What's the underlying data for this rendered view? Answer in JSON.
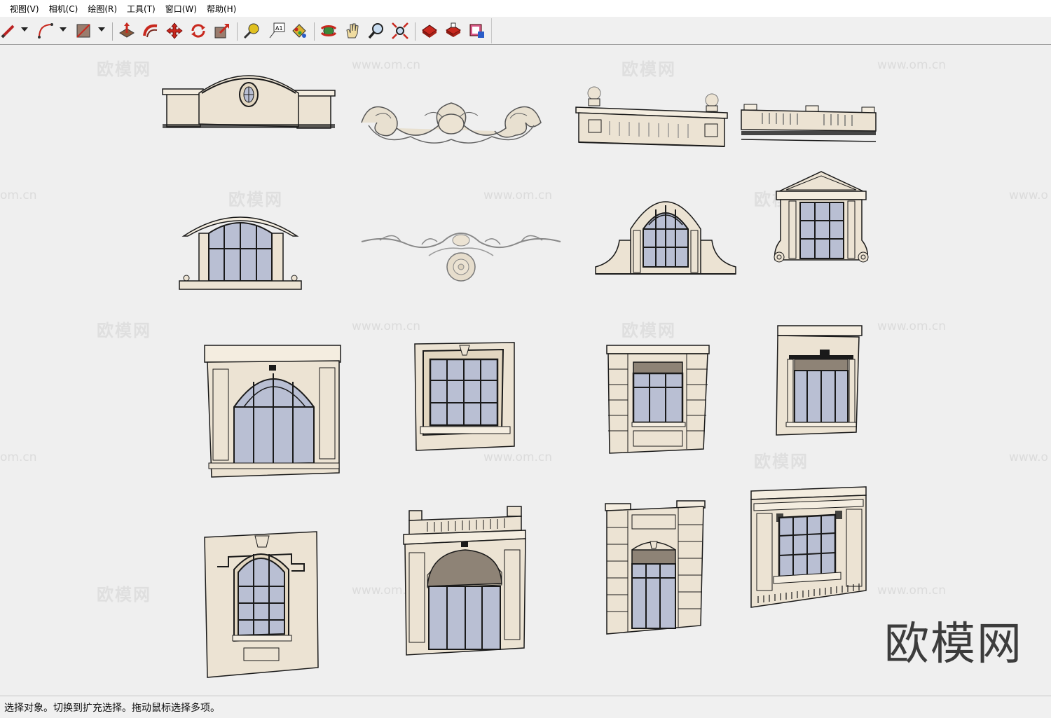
{
  "menu": {
    "items": [
      {
        "label": "视图(V)"
      },
      {
        "label": "相机(C)"
      },
      {
        "label": "绘图(R)"
      },
      {
        "label": "工具(T)"
      },
      {
        "label": "窗口(W)"
      },
      {
        "label": "帮助(H)"
      }
    ]
  },
  "toolbar": {
    "tools": [
      "pencil-icon",
      "arc-icon",
      "rectangle-icon",
      "push-pull-icon",
      "follow-me-icon",
      "move-icon",
      "rotate-icon",
      "scale-icon",
      "tape-measure-icon",
      "text-icon",
      "paint-bucket-icon",
      "orbit-icon",
      "pan-icon",
      "zoom-icon",
      "zoom-extents-icon",
      "warehouse-icon",
      "share-model-icon",
      "extension-icon"
    ],
    "text_tool_label": "A1"
  },
  "watermarks": {
    "site_name": "欧模网",
    "site_url": "www.om.cn",
    "site_url_partial": "om.cn",
    "site_url_cut": "www.o"
  },
  "viewport": {
    "big_watermark": "欧模网"
  },
  "status": {
    "text": "选择对象。切换到扩充选择。拖动鼠标选择多项。"
  },
  "colors": {
    "stone": "#ece3d3",
    "stone_dark": "#d8cdb8",
    "glass": "#b9bfd3",
    "outline": "#1a1a1a",
    "awning": "#8e8376",
    "accent_red": "#c8281e"
  }
}
